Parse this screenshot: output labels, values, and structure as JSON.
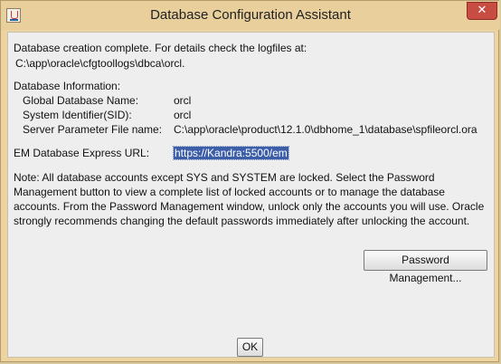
{
  "window": {
    "title": "Database Configuration Assistant",
    "close_label": "✕"
  },
  "completion": {
    "line1": "Database creation complete. For details check the logfiles at:",
    "log_path": "C:\\app\\oracle\\cfgtoollogs\\dbca\\orcl."
  },
  "db_info": {
    "heading": "Database Information:",
    "rows": [
      {
        "label": "Global Database Name:",
        "value": "orcl"
      },
      {
        "label": "System Identifier(SID):",
        "value": "orcl"
      },
      {
        "label": "Server Parameter File name:",
        "value": "C:\\app\\oracle\\product\\12.1.0\\dbhome_1\\database\\spfileorcl.ora"
      }
    ]
  },
  "em": {
    "label": "EM Database Express URL:",
    "url": "https://Kandra:5500/em"
  },
  "note": "Note: All database accounts except SYS and SYSTEM are locked. Select the Password Management button to view a complete list of locked accounts or to manage the database accounts. From the Password Management window, unlock only the accounts you will use. Oracle strongly recommends changing the default passwords immediately after unlocking the account.",
  "buttons": {
    "password_management": "Password Management...",
    "ok": "OK"
  },
  "colors": {
    "title_bar": "#e8cf9b",
    "close_button": "#c74d43",
    "selection": "#3c5ea9",
    "panel": "#eeeeee"
  },
  "icons": {
    "app": "java-icon",
    "close": "close-icon"
  }
}
